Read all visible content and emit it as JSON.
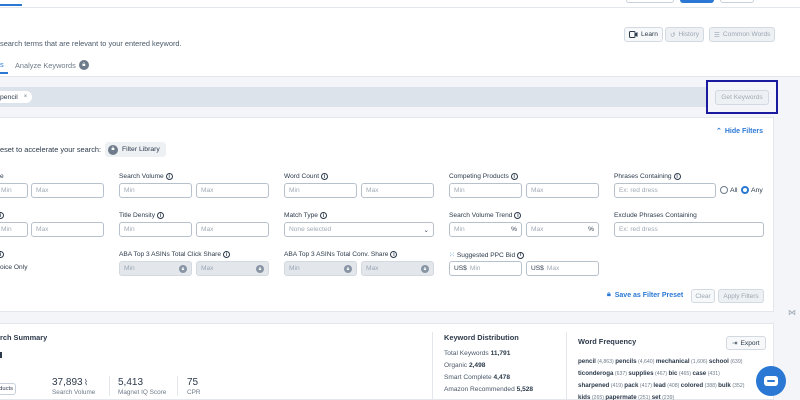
{
  "toolbar": {
    "description": "search terms that are relevant to your entered keyword.",
    "learn_label": "Learn",
    "history_label": "History",
    "common_words_label": "Common Words"
  },
  "tabs": {
    "analyze_label": "Analyze Keywords",
    "first_tab_fragment": "s"
  },
  "search": {
    "chip_label": "pencil",
    "chip_close": "×",
    "get_keywords_label": "Get Keywords"
  },
  "filters": {
    "preset_text": "eset to accelerate your search:",
    "filter_library_label": "Filter Library",
    "hide_filters_label": "Hide Filters",
    "row1": {
      "col0_label": "e",
      "search_volume_label": "Search Volume",
      "word_count_label": "Word Count",
      "competing_products_label": "Competing Products",
      "phrases_containing_label": "Phrases Containing",
      "phrases_placeholder": "Ex: red dress",
      "any_all": {
        "all": "All",
        "any": "Any"
      }
    },
    "row2": {
      "title_density_label": "Title Density",
      "match_type_label": "Match Type",
      "match_type_value": "None selected",
      "search_volume_trend_label": "Search Volume Trend",
      "exclude_phrases_label": "Exclude Phrases Containing",
      "exclude_placeholder": "Ex: red dress",
      "percent": "%"
    },
    "row3": {
      "col0_text": "oice Only",
      "aba_click_label": "ABA Top 3 ASINs Total Click Share",
      "aba_conv_label": "ABA Top 3 ASINs Total Conv. Share",
      "ppc_label": "Suggested PPC Bid",
      "currency_prefix": "US$"
    },
    "min": "Min",
    "max": "Max",
    "save_preset_label": "Save as Filter Preset",
    "clear_label": "Clear",
    "apply_label": "Apply Filters"
  },
  "summary": {
    "title": "rch Summary",
    "products_fragment": "oducts",
    "metrics": [
      {
        "value": "37,893",
        "label": "Search Volume"
      },
      {
        "value": "5,413",
        "label": "Magnet IQ Score"
      },
      {
        "value": "75",
        "label": "CPR"
      }
    ],
    "keyword_distribution": {
      "title": "Keyword Distribution",
      "rows": [
        {
          "label": "Total Keywords",
          "value": "11,791"
        },
        {
          "label": "Organic",
          "value": "2,498"
        },
        {
          "label": "Smart Complete",
          "value": "4,478"
        },
        {
          "label": "Amazon Recommended",
          "value": "5,528"
        }
      ]
    },
    "word_frequency": {
      "title": "Word Frequency",
      "export_label": "Export",
      "lines": [
        [
          [
            "pencil",
            "(4,863)"
          ],
          [
            "pencils",
            "(4,640)"
          ],
          [
            "mechanical",
            "(1,606)"
          ],
          [
            "school",
            "(639)"
          ]
        ],
        [
          [
            "ticonderoga",
            "(637)"
          ],
          [
            "supplies",
            "(467)"
          ],
          [
            "bic",
            "(465)"
          ],
          [
            "case",
            "(431)"
          ]
        ],
        [
          [
            "sharpened",
            "(419)"
          ],
          [
            "pack",
            "(417)"
          ],
          [
            "lead",
            "(408)"
          ],
          [
            "colored",
            "(388)"
          ],
          [
            "bulk",
            "(352)"
          ]
        ],
        [
          [
            "kids",
            "(265)"
          ],
          [
            "papermate",
            "(251)"
          ],
          [
            "set",
            "(239)"
          ]
        ]
      ]
    }
  }
}
